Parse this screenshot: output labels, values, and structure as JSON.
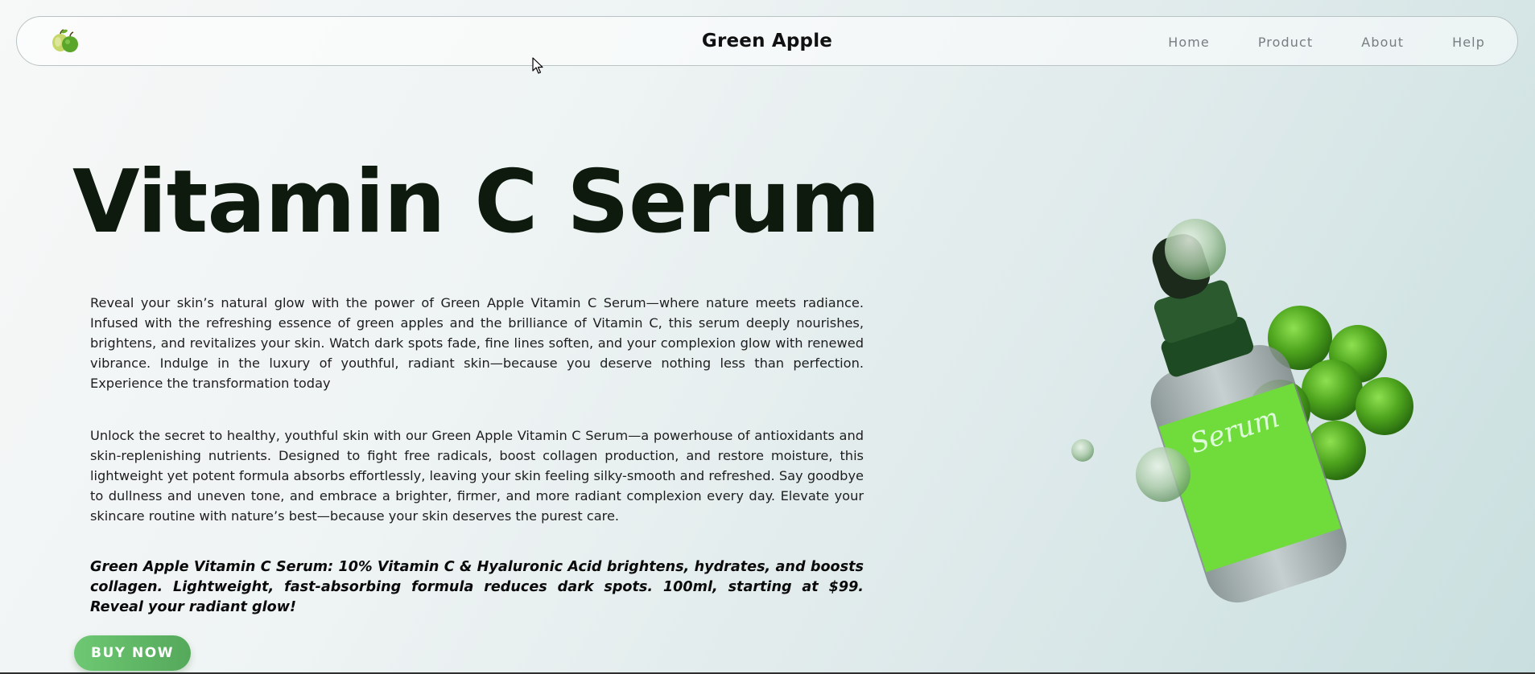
{
  "nav": {
    "logo_icon": "green-apples-icon",
    "brand": "Green Apple",
    "links": [
      "Home",
      "Product",
      "About",
      "Help"
    ]
  },
  "hero": {
    "title": "Vitamin C Serum",
    "paragraph_1": "Reveal your skin’s natural glow with the power of Green Apple Vitamin C Serum—where nature meets radiance. Infused with the refreshing essence of green apples and the brilliance of Vitamin C, this serum deeply nourishes, brightens, and revitalizes your skin. Watch dark spots fade, fine lines soften, and your complexion glow with renewed vibrance. Indulge in the luxury of youthful, radiant skin—because you deserve nothing less than perfection. Experience the transformation today",
    "paragraph_2": "Unlock the secret to healthy, youthful skin with our Green Apple Vitamin C Serum—a powerhouse of antioxidants and skin-replenishing nutrients. Designed to fight free radicals, boost collagen production, and restore moisture, this lightweight yet potent formula absorbs effortlessly, leaving your skin feeling silky-smooth and refreshed. Say goodbye to dullness and uneven tone, and embrace a brighter, firmer, and more radiant complexion every day. Elevate your skincare routine with nature’s best—because your skin deserves the purest care.",
    "summary": "Green Apple Vitamin C Serum: 10% Vitamin C & Hyaluronic Acid brightens, hydrates, and boosts collagen. Lightweight, fast-absorbing formula reduces dark spots. 100ml, starting at $99. Reveal your radiant glow!",
    "buy_label": "BUY NOW"
  },
  "colors": {
    "accent": "#5fb865",
    "title": "#0d1a0d",
    "bottle_label": "#6fdc3c"
  }
}
